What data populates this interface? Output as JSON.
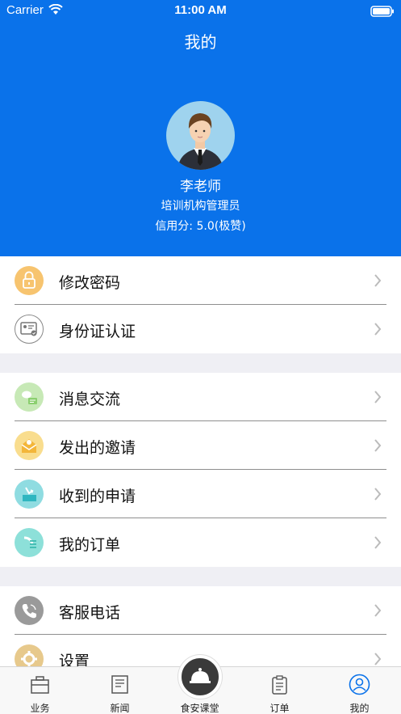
{
  "status_bar": {
    "carrier": "Carrier",
    "time": "11:00 AM"
  },
  "page": {
    "title": "我的"
  },
  "profile": {
    "name": "李老师",
    "role": "培训机构管理员",
    "credit": "信用分: 5.0(极赞)"
  },
  "groups": [
    {
      "items": [
        {
          "label": "修改密码",
          "icon": "lock-icon",
          "color": "#f7c46f"
        },
        {
          "label": "身份证认证",
          "icon": "id-card-icon",
          "color": "#ffffff"
        }
      ]
    },
    {
      "items": [
        {
          "label": "消息交流",
          "icon": "chat-icon",
          "color": "#b6e1a3"
        },
        {
          "label": "发出的邀请",
          "icon": "envelope-out-icon",
          "color": "#f6d074"
        },
        {
          "label": "收到的申请",
          "icon": "inbox-icon",
          "color": "#6ed1d8"
        },
        {
          "label": "我的订单",
          "icon": "list-icon",
          "color": "#6fd6cf"
        }
      ]
    },
    {
      "items": [
        {
          "label": "客服电话",
          "icon": "phone-icon",
          "color": "#9a9a9a"
        },
        {
          "label": "设置",
          "icon": "gear-icon",
          "color": "#e7c98c"
        }
      ]
    }
  ],
  "tabbar": [
    {
      "label": "业务",
      "icon": "briefcase-icon"
    },
    {
      "label": "新闻",
      "icon": "newspaper-icon"
    },
    {
      "label": "食安课堂",
      "icon": "cloche-icon"
    },
    {
      "label": "订单",
      "icon": "clipboard-icon"
    },
    {
      "label": "我的",
      "icon": "user-icon",
      "active": true
    }
  ],
  "colors": {
    "header": "#0a72ea",
    "background": "#efeff4",
    "active_tab": "#0a72ea"
  }
}
